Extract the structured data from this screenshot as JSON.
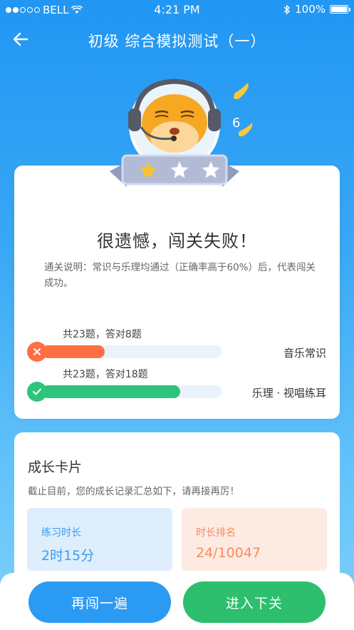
{
  "status_bar": {
    "carrier": "BELL",
    "time": "4:21 PM",
    "battery": "100%"
  },
  "nav": {
    "title": "初级 综合模拟测试（一）"
  },
  "result": {
    "stars_earned": 1,
    "stars_total": 3,
    "title": "很遗憾，闯关失败！",
    "description": "通关说明：常识与乐理均通过（正确率高于60%）后，代表闯关成功。",
    "progress": [
      {
        "count_text": "共23题，答对8题",
        "label": "音乐常识",
        "fraction": 0.35,
        "status": "fail",
        "color": "#ff6e45"
      },
      {
        "count_text": "共23题，答对18题",
        "label": "乐理 · 视唱练耳",
        "fraction": 0.77,
        "status": "pass",
        "color": "#2dc47c"
      }
    ]
  },
  "growth": {
    "title": "成长卡片",
    "description": "截止目前，您的成长记录汇总如下，请再接再厉！",
    "stats": [
      {
        "label": "练习时长",
        "value": "2时15分",
        "color": "#3d9bf0"
      },
      {
        "label": "时长排名",
        "value": "24/10047",
        "color": "#f48c5e"
      }
    ]
  },
  "buttons": {
    "retry": "再闯一遍",
    "next": "进入下关"
  }
}
